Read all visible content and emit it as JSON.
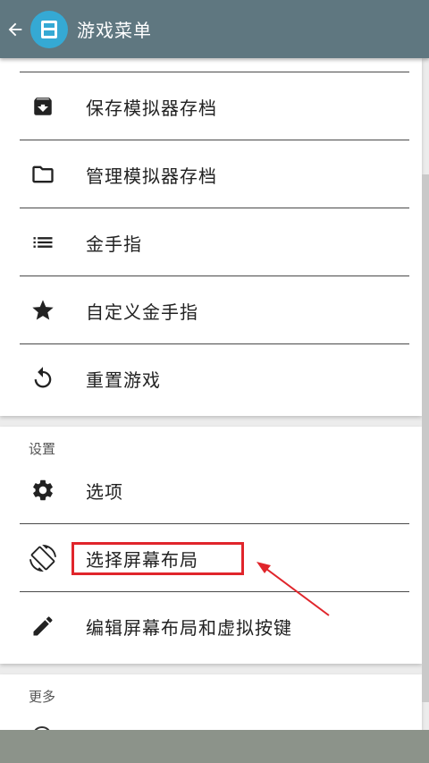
{
  "appbar": {
    "title": "游戏菜单",
    "back_icon": "arrow-left-icon",
    "logo_icon": "app-logo-icon"
  },
  "game_items": [
    {
      "label": "保存模拟器存档",
      "icon": "save-archive-icon"
    },
    {
      "label": "管理模拟器存档",
      "icon": "folder-icon"
    },
    {
      "label": "金手指",
      "icon": "list-icon"
    },
    {
      "label": "自定义金手指",
      "icon": "star-icon"
    },
    {
      "label": "重置游戏",
      "icon": "reset-icon"
    }
  ],
  "settings": {
    "header": "设置",
    "items": [
      {
        "label": "选项",
        "icon": "gear-icon"
      },
      {
        "label": "选择屏幕布局",
        "icon": "screen-rotation-icon"
      },
      {
        "label": "编辑屏幕布局和虚拟按键",
        "icon": "pencil-icon"
      }
    ]
  },
  "more": {
    "header": "更多"
  },
  "colors": {
    "appbar": "#5f7780",
    "logo": "#35a9d4",
    "highlight": "#e0252b"
  }
}
